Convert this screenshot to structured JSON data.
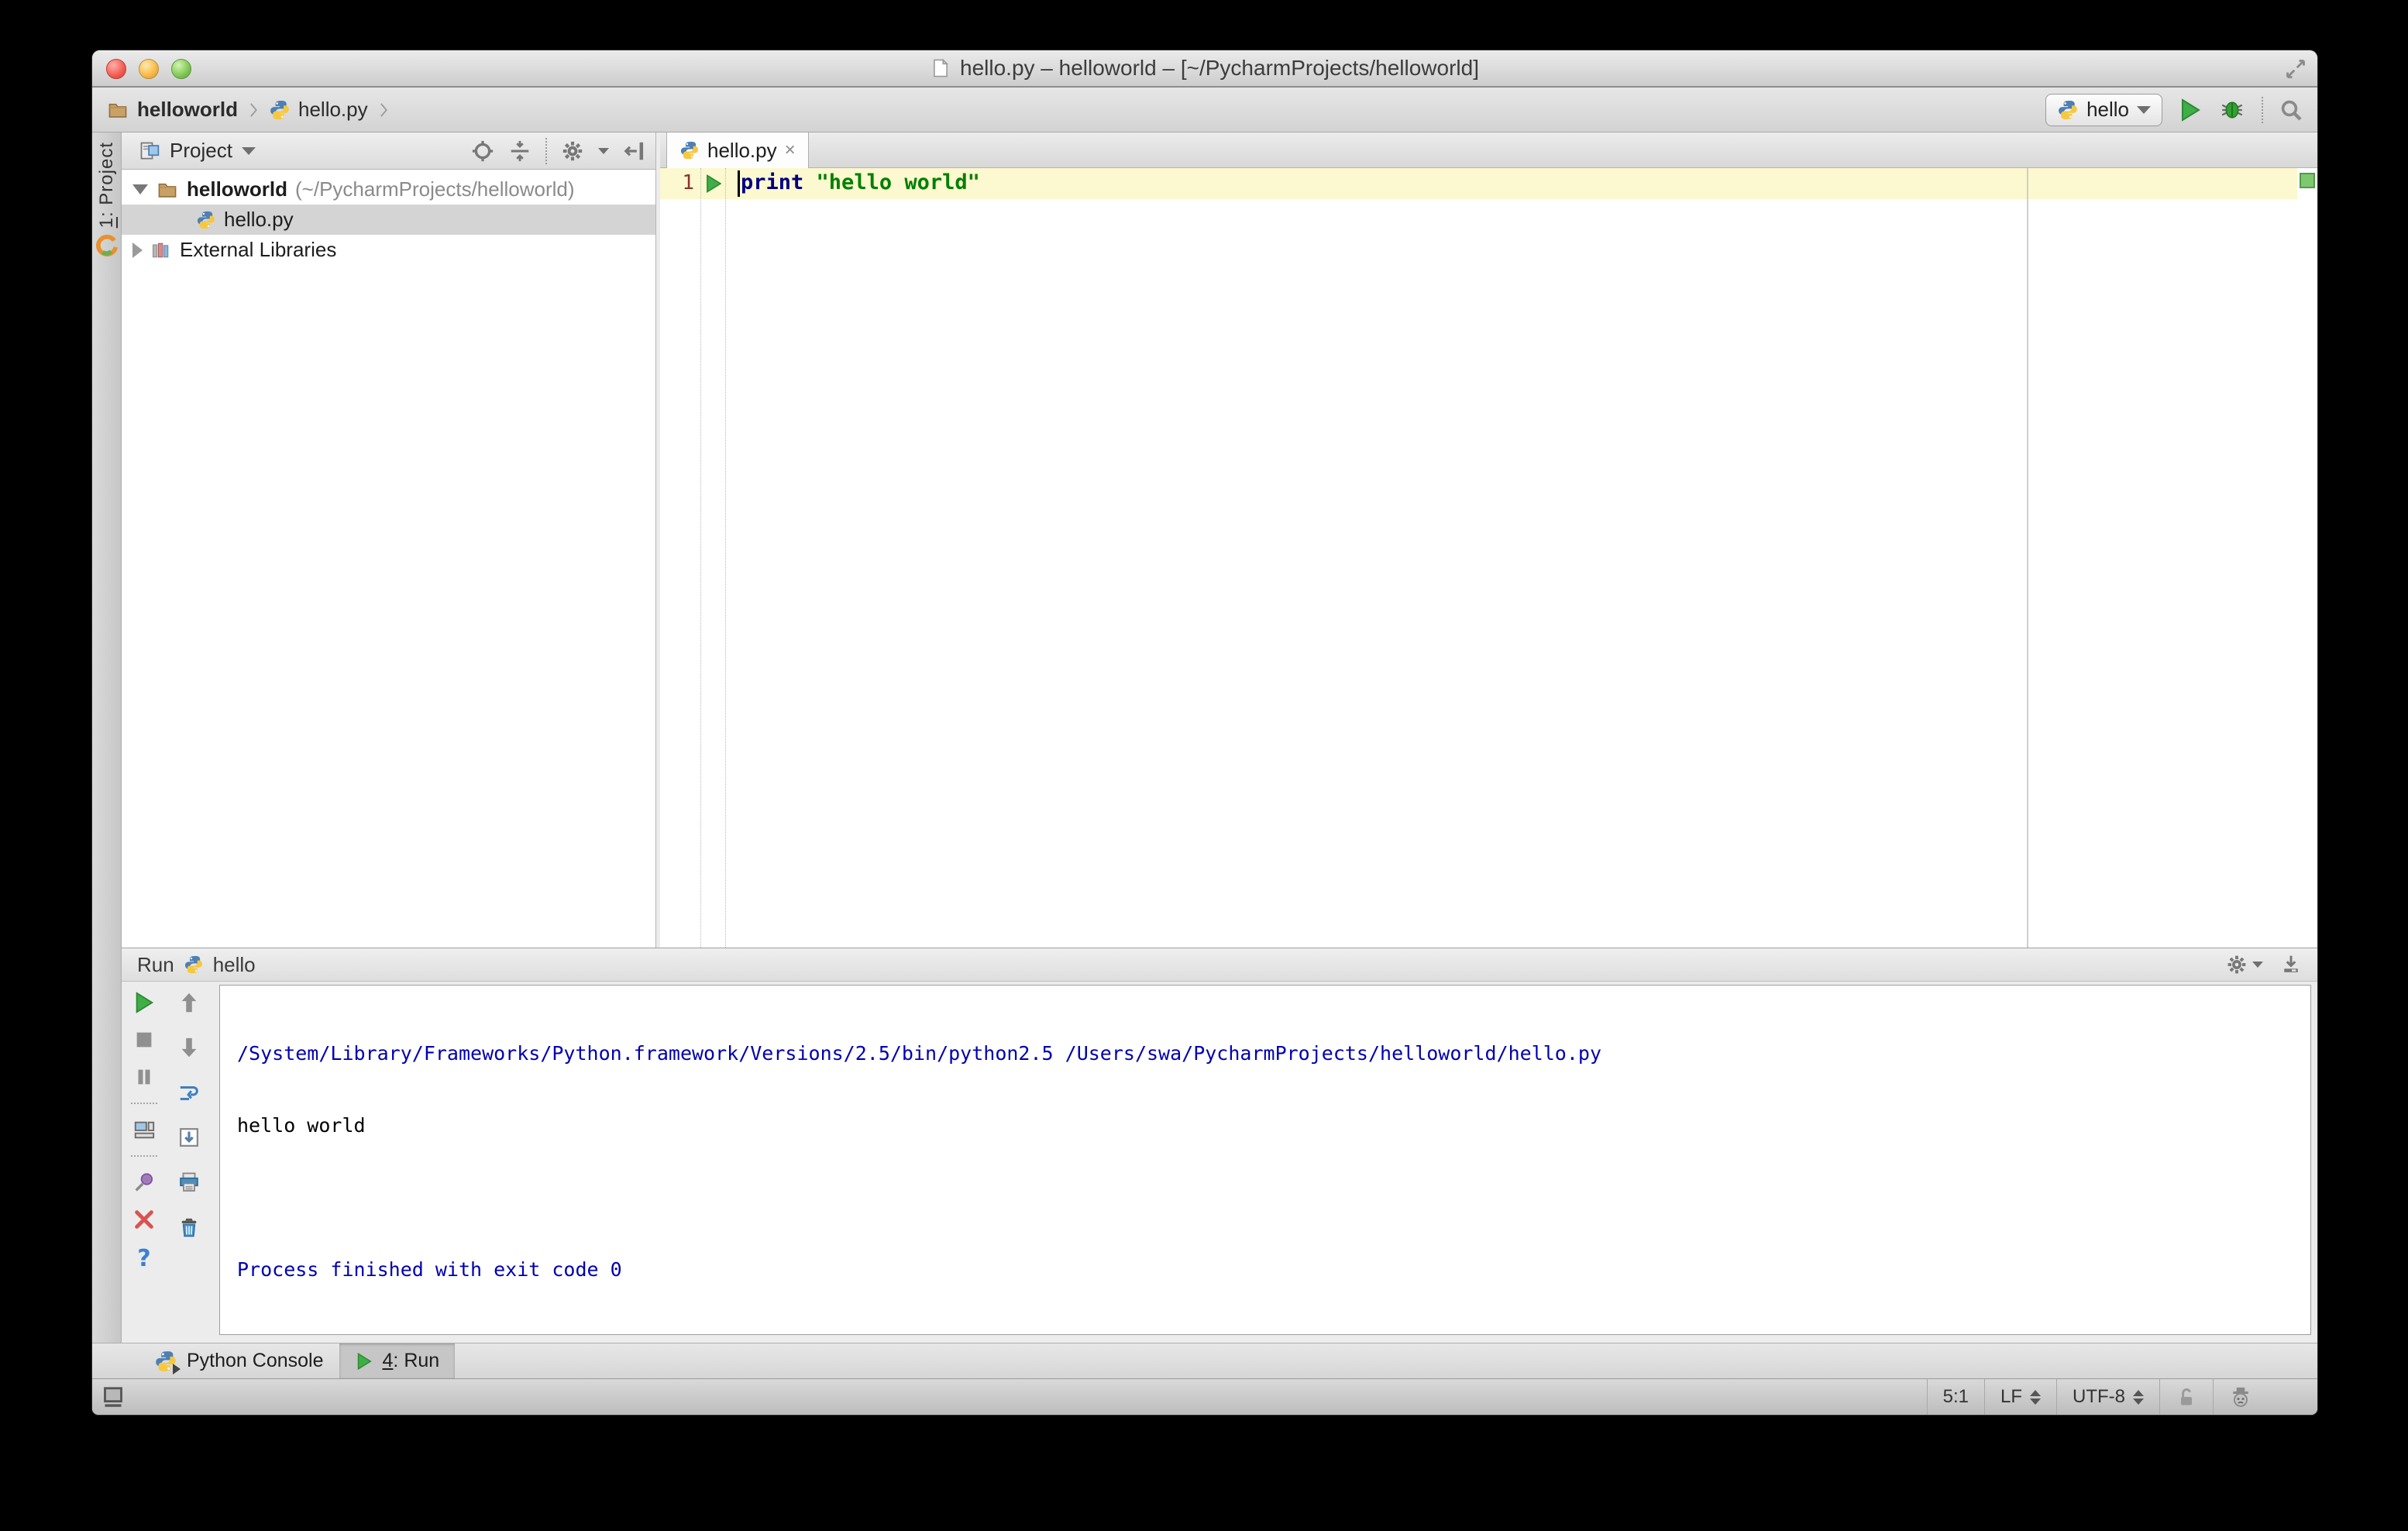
{
  "window": {
    "title": "hello.py – helloworld – [~/PycharmProjects/helloworld]"
  },
  "navbar": {
    "breadcrumbs": [
      {
        "label": "helloworld"
      },
      {
        "label": "hello.py"
      }
    ],
    "run_config": "hello"
  },
  "tool_stripe": {
    "project_mnemonic": "1",
    "project_label": ": Project"
  },
  "project_panel": {
    "header": "Project",
    "tree": [
      {
        "name": "helloworld",
        "path_suffix": "(~/PycharmProjects/helloworld)"
      },
      {
        "name": "hello.py"
      },
      {
        "name": "External Libraries"
      }
    ]
  },
  "editor": {
    "tab": "hello.py",
    "tab_close": "×",
    "line_number": "1",
    "code": {
      "keyword": "print",
      "space": " ",
      "string": "\"hello world\""
    }
  },
  "run_panel": {
    "title": "Run",
    "tab": "hello",
    "help_glyph": "?",
    "console_lines": [
      {
        "text": "/System/Library/Frameworks/Python.framework/Versions/2.5/bin/python2.5 /Users/swa/PycharmProjects/helloworld/hello.py",
        "color": "blue"
      },
      {
        "text": "hello world",
        "color": "black"
      },
      {
        "text": "",
        "color": "black"
      },
      {
        "text": "Process finished with exit code 0",
        "color": "blue"
      }
    ]
  },
  "bottom_bar": {
    "python_console": "Python Console",
    "run_mnemonic": "4",
    "run_label": ": Run"
  },
  "status_bar": {
    "caret_position": "5:1",
    "line_separator": "LF",
    "encoding": "UTF-8"
  },
  "colors": {
    "keyword": "#000080",
    "string": "#008000",
    "console_info": "#0000b2",
    "current_line": "#fcf8cf",
    "selection": "#d4d4d4",
    "run_green": "#3fae46",
    "inspection_ok": "#7ec96f",
    "line_number": "#8b3232"
  },
  "icons": {
    "breadcrumb_folder": "folder",
    "python_file": "python-logo",
    "run": "green-play",
    "debug": "green-bug",
    "search": "magnifier",
    "settings": "gear",
    "locate": "crosshair",
    "collapse_all": "arrows-to-line",
    "hide_panel": "bar-left-arrow",
    "pin": "purple-pin",
    "close": "red-x",
    "help": "?",
    "soft_wrap": "blue-loop-arrows",
    "scroll_end": "box-down-arrow",
    "print": "printer",
    "clear": "trash",
    "lock": "open-padlock",
    "inspections": "hector-face",
    "toggle_toolwindows": "square-underline"
  }
}
